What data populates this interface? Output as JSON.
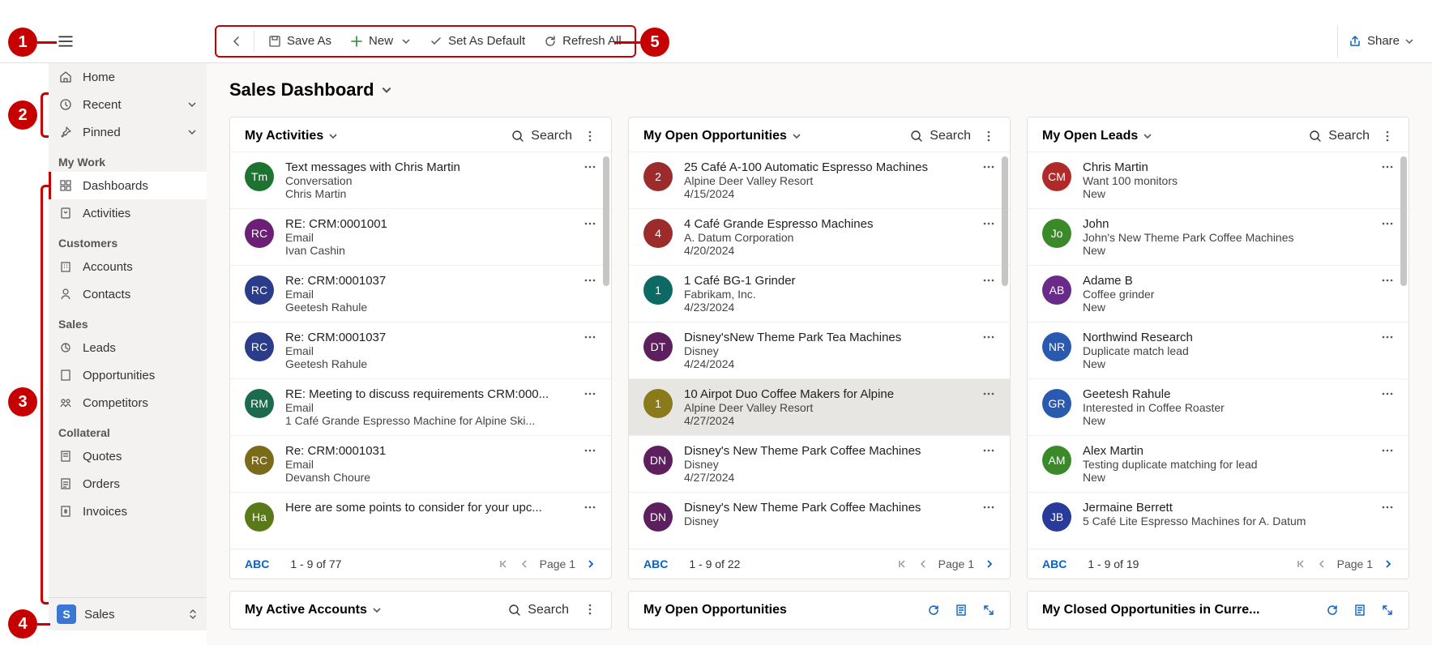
{
  "toolbar": {
    "save_as": "Save As",
    "new": "New",
    "set_default": "Set As Default",
    "refresh_all": "Refresh All",
    "share": "Share"
  },
  "sidebar": {
    "home": "Home",
    "recent": "Recent",
    "pinned": "Pinned",
    "sections": {
      "my_work": "My Work",
      "customers": "Customers",
      "sales": "Sales",
      "collateral": "Collateral"
    },
    "items": {
      "dashboards": "Dashboards",
      "activities": "Activities",
      "accounts": "Accounts",
      "contacts": "Contacts",
      "leads": "Leads",
      "opportunities": "Opportunities",
      "competitors": "Competitors",
      "quotes": "Quotes",
      "orders": "Orders",
      "invoices": "Invoices"
    },
    "app_switch": {
      "letter": "S",
      "label": "Sales"
    }
  },
  "page": {
    "title": "Sales Dashboard"
  },
  "cards": {
    "a": {
      "title": "My Activities",
      "search": "Search",
      "footer_abc": "ABC",
      "footer_count": "1 - 9 of 77",
      "footer_page": "Page 1",
      "items": [
        {
          "av": "Tm",
          "color": "#1c7430",
          "t": "Text messages with Chris Martin",
          "s1": "Conversation",
          "s2": "Chris Martin"
        },
        {
          "av": "RC",
          "color": "#6b2075",
          "t": "RE: CRM:0001001",
          "s1": "Email",
          "s2": "Ivan Cashin"
        },
        {
          "av": "RC",
          "color": "#2b3c8a",
          "t": "Re: CRM:0001037",
          "s1": "Email",
          "s2": "Geetesh Rahule"
        },
        {
          "av": "RC",
          "color": "#2b3c8a",
          "t": "Re: CRM:0001037",
          "s1": "Email",
          "s2": "Geetesh Rahule"
        },
        {
          "av": "RM",
          "color": "#1c6b4e",
          "t": "RE: Meeting to discuss requirements CRM:000...",
          "s1": "Email",
          "s2": "1 Café Grande Espresso Machine for Alpine Ski..."
        },
        {
          "av": "RC",
          "color": "#7a6a1a",
          "t": "Re: CRM:0001031",
          "s1": "Email",
          "s2": "Devansh Choure"
        },
        {
          "av": "Ha",
          "color": "#5a7a1a",
          "t": "Here are some points to consider for your upc...",
          "s1": "",
          "s2": ""
        }
      ]
    },
    "b": {
      "title": "My Open Opportunities",
      "search": "Search",
      "footer_abc": "ABC",
      "footer_count": "1 - 9 of 22",
      "footer_page": "Page 1",
      "items": [
        {
          "av": "2",
          "color": "#9c2c2c",
          "t": "25 Café A-100 Automatic Espresso Machines",
          "s1": "Alpine Deer Valley Resort",
          "s2": "4/15/2024"
        },
        {
          "av": "4",
          "color": "#9c2c2c",
          "t": "4 Café Grande Espresso Machines",
          "s1": "A. Datum Corporation",
          "s2": "4/20/2024"
        },
        {
          "av": "1",
          "color": "#0d6964",
          "t": "1 Café BG-1 Grinder",
          "s1": "Fabrikam, Inc.",
          "s2": "4/23/2024"
        },
        {
          "av": "DT",
          "color": "#5e1f5e",
          "t": "Disney'sNew Theme Park Tea Machines",
          "s1": "Disney",
          "s2": "4/24/2024",
          "sel": false
        },
        {
          "av": "1",
          "color": "#8a7a1a",
          "t": "10 Airpot Duo Coffee Makers for Alpine",
          "s1": "Alpine Deer Valley Resort",
          "s2": "4/27/2024",
          "sel": true
        },
        {
          "av": "DN",
          "color": "#5e1f5e",
          "t": "Disney's New Theme Park Coffee Machines",
          "s1": "Disney",
          "s2": "4/27/2024"
        },
        {
          "av": "DN",
          "color": "#5e1f5e",
          "t": "Disney's New Theme Park Coffee Machines",
          "s1": "Disney",
          "s2": ""
        }
      ]
    },
    "c": {
      "title": "My Open Leads",
      "search": "Search",
      "footer_abc": "ABC",
      "footer_count": "1 - 9 of 19",
      "footer_page": "Page 1",
      "items": [
        {
          "av": "CM",
          "color": "#b02a2a",
          "t": "Chris Martin",
          "s1": "Want 100 monitors",
          "s2": "New"
        },
        {
          "av": "Jo",
          "color": "#3a8a2a",
          "t": "John",
          "s1": "John's New Theme Park Coffee Machines",
          "s2": "New"
        },
        {
          "av": "AB",
          "color": "#6a2a8a",
          "t": "Adame B",
          "s1": "Coffee grinder",
          "s2": "New"
        },
        {
          "av": "NR",
          "color": "#2a5ab0",
          "t": "Northwind Research",
          "s1": "Duplicate match lead",
          "s2": "New"
        },
        {
          "av": "GR",
          "color": "#2a5ab0",
          "t": "Geetesh Rahule",
          "s1": "Interested in Coffee Roaster",
          "s2": "New"
        },
        {
          "av": "AM",
          "color": "#3a8a2a",
          "t": "Alex Martin",
          "s1": "Testing duplicate matching for lead",
          "s2": "New"
        },
        {
          "av": "JB",
          "color": "#2a3a9a",
          "t": "Jermaine Berrett",
          "s1": "5 Café Lite Espresso Machines for A. Datum",
          "s2": ""
        }
      ]
    }
  },
  "cards2": {
    "a": {
      "title": "My Active Accounts",
      "search": "Search"
    },
    "b": {
      "title": "My Open Opportunities"
    },
    "c": {
      "title": "My Closed Opportunities in Curre..."
    }
  },
  "annotations": {
    "1": "1",
    "2": "2",
    "3": "3",
    "4": "4",
    "5": "5"
  }
}
